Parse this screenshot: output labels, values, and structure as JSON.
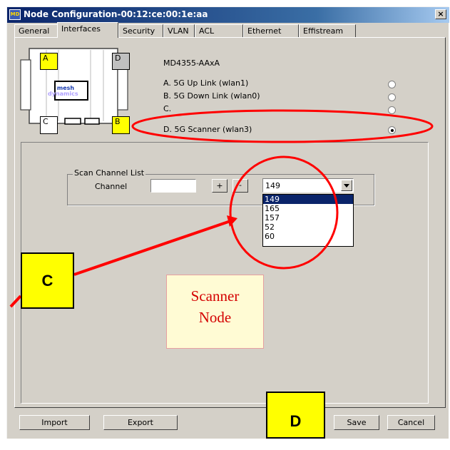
{
  "window": {
    "title": "Node Configuration-00:12:ce:00:1e:aa",
    "icon_label": "MD",
    "close_glyph": "×"
  },
  "tabs": [
    {
      "label": "General",
      "active": false
    },
    {
      "label": "Interfaces",
      "active": true
    },
    {
      "label": "Security",
      "active": false
    },
    {
      "label": "VLAN",
      "active": false
    },
    {
      "label": "ACL",
      "active": false
    },
    {
      "label": "Ethernet",
      "active": false
    },
    {
      "label": "Effistream",
      "active": false
    }
  ],
  "device": {
    "model": "MD4355-AAxA",
    "logo_line1": "mesh",
    "logo_line2": "dynamics",
    "port_a": "A",
    "port_b": "B",
    "port_c": "C",
    "port_d": "D"
  },
  "interfaces": [
    {
      "label": "A. 5G  Up Link (wlan1)",
      "selected": false
    },
    {
      "label": "B. 5G  Down Link (wlan0)",
      "selected": false
    },
    {
      "label": "C.",
      "selected": false
    },
    {
      "label": "D. 5G  Scanner (wlan3)",
      "selected": true
    }
  ],
  "scan": {
    "group_title": "Scan Channel List",
    "channel_label": "Channel",
    "channel_value": "",
    "add_label": "+",
    "remove_label": "-",
    "selected_channel": "149",
    "options": [
      "149",
      "165",
      "157",
      "52",
      "60"
    ]
  },
  "footer": {
    "import_label": "Import",
    "export_label": "Export",
    "save_label": "Save",
    "cancel_label": "Cancel"
  },
  "annotations": {
    "callout_c": "C",
    "callout_d": "D",
    "scanner_line1": "Scanner",
    "scanner_line2": "Node",
    "highlight_color": "#ff0000",
    "callout_color": "#ffff00"
  }
}
